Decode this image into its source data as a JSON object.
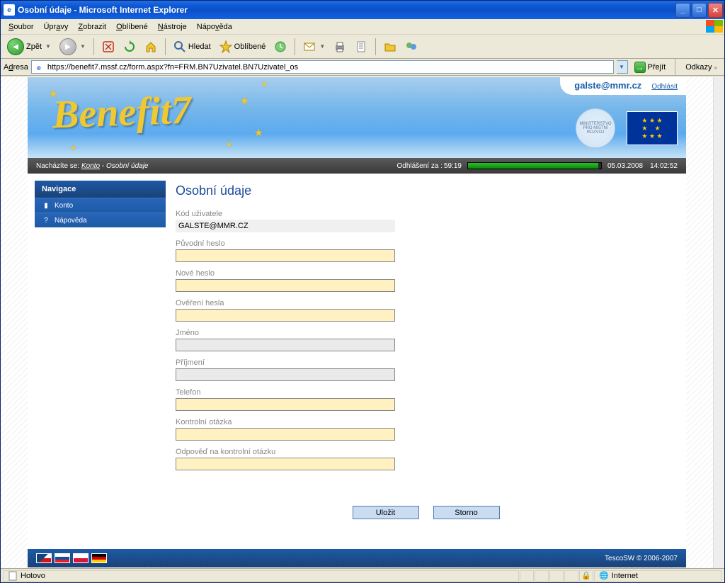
{
  "window": {
    "title": "Osobní údaje - Microsoft Internet Explorer"
  },
  "menu": {
    "items": [
      "Soubor",
      "Úpravy",
      "Zobrazit",
      "Oblíbené",
      "Nástroje",
      "Nápověda"
    ]
  },
  "toolbar": {
    "back": "Zpět",
    "search": "Hledat",
    "favorites": "Oblíbené"
  },
  "address": {
    "label": "Adresa",
    "url": "https://benefit7.mssf.cz/form.aspx?fn=FRM.BN7Uzivatel.BN7Uzivatel_os",
    "go": "Přejít",
    "links": "Odkazy"
  },
  "header": {
    "app_name": "Benefit7",
    "user_email": "galste@mmr.cz",
    "logout": "Odhlásit"
  },
  "breadcrumb": {
    "prefix": "Nacházíte se:",
    "link": "Konto",
    "sep": "-",
    "current": "Osobní údaje",
    "logout_label": "Odhlášení za :",
    "logout_time": "59:19",
    "date": "05.03.2008",
    "time": "14:02:52"
  },
  "nav": {
    "title": "Navigace",
    "items": [
      {
        "label": "Konto",
        "icon": "account"
      },
      {
        "label": "Nápověda",
        "icon": "help"
      }
    ]
  },
  "form": {
    "title": "Osobní údaje",
    "fields": {
      "user_code": {
        "label": "Kód uživatele",
        "value": "GALSTE@MMR.CZ"
      },
      "old_pw": {
        "label": "Původní heslo"
      },
      "new_pw": {
        "label": "Nové heslo"
      },
      "conf_pw": {
        "label": "Ověření hesla"
      },
      "fname": {
        "label": "Jméno"
      },
      "lname": {
        "label": "Příjmení"
      },
      "phone": {
        "label": "Telefon"
      },
      "question": {
        "label": "Kontrolní otázka"
      },
      "answer": {
        "label": "Odpověď na kontrolní otázku"
      }
    },
    "buttons": {
      "save": "Uložit",
      "cancel": "Storno"
    }
  },
  "footer": {
    "copy": "TescoSW © 2006-2007"
  },
  "status": {
    "done": "Hotovo",
    "zone": "Internet"
  }
}
